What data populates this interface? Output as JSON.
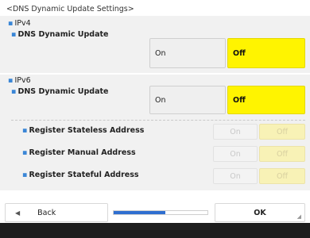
{
  "screen": {
    "title": "<DNS Dynamic Update Settings>"
  },
  "ipv4": {
    "heading": "IPv4",
    "dns_label": "DNS Dynamic Update",
    "on_label": "On",
    "off_label": "Off",
    "selected": "Off"
  },
  "ipv6": {
    "heading": "IPv6",
    "dns_label": "DNS Dynamic Update",
    "on_label": "On",
    "off_label": "Off",
    "selected": "Off",
    "sub_settings": [
      {
        "label": "Register Stateless Address",
        "on_label": "On",
        "off_label": "Off",
        "enabled": false
      },
      {
        "label": "Register Manual Address",
        "on_label": "On",
        "off_label": "Off",
        "enabled": false
      },
      {
        "label": "Register Stateful Address",
        "on_label": "On",
        "off_label": "Off",
        "enabled": false
      }
    ]
  },
  "bottom_bar": {
    "back_label": "Back",
    "back_icon": "left-arrow-icon",
    "ok_label": "OK",
    "progress_percent": 55
  },
  "colors": {
    "selected": "#fff400",
    "accent": "#2f6fd0",
    "bullet": "#3a86d6"
  }
}
